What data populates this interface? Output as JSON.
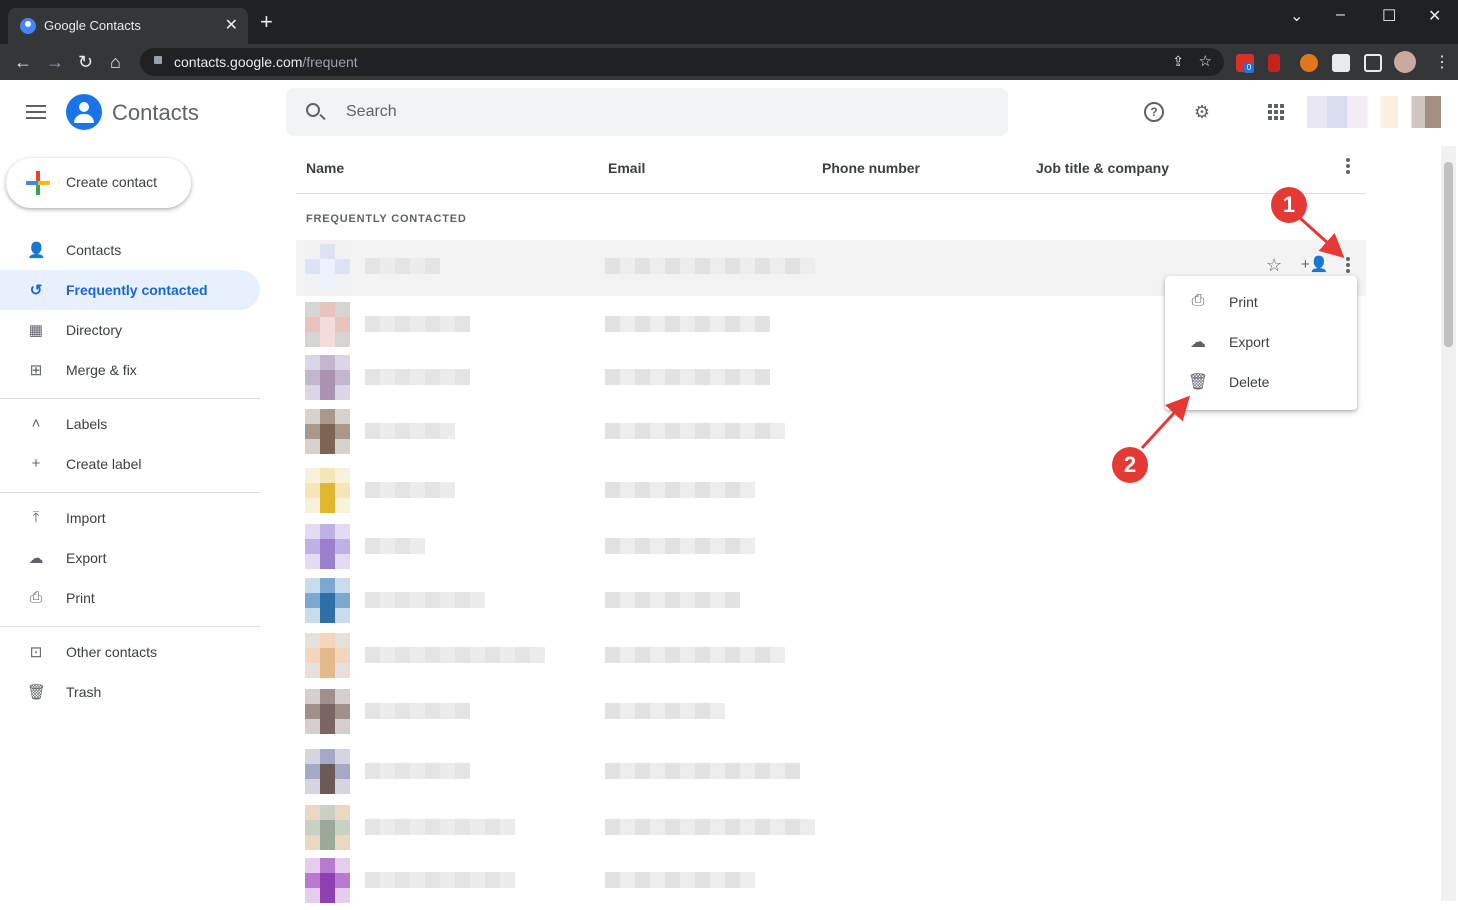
{
  "browser": {
    "tab_title": "Google Contacts",
    "tab_close": "✕",
    "new_tab": "+",
    "url_host": "contacts.google.com",
    "url_path": "/frequent",
    "extension_badge": "0"
  },
  "header": {
    "brand": "Contacts",
    "search_placeholder": "Search",
    "help_icon": "?"
  },
  "sidebar": {
    "create_label": "Create contact",
    "items": [
      {
        "label": "Contacts",
        "icon": "person-icon"
      },
      {
        "label": "Frequently contacted",
        "icon": "history-icon",
        "active": true
      },
      {
        "label": "Directory",
        "icon": "building-icon"
      },
      {
        "label": "Merge & fix",
        "icon": "merge-icon"
      }
    ],
    "labels_header": "Labels",
    "create_label_item": "Create label",
    "tools": [
      {
        "label": "Import",
        "icon": "upload-icon"
      },
      {
        "label": "Export",
        "icon": "cloud-upload-icon"
      },
      {
        "label": "Print",
        "icon": "print-icon"
      }
    ],
    "other": [
      {
        "label": "Other contacts",
        "icon": "archive-icon"
      },
      {
        "label": "Trash",
        "icon": "trash-icon"
      }
    ]
  },
  "table": {
    "columns": [
      "Name",
      "Email",
      "Phone number",
      "Job title & company"
    ],
    "section_label": "FREQUENTLY CONTACTED",
    "row_count": 12
  },
  "context_menu": {
    "items": [
      {
        "label": "Print",
        "icon": "print-icon"
      },
      {
        "label": "Export",
        "icon": "cloud-export-icon"
      },
      {
        "label": "Delete",
        "icon": "trash-icon"
      }
    ]
  },
  "annotations": [
    "1",
    "2"
  ],
  "colors": {
    "accent": "#1a73e8",
    "active_bg": "#e8f0fe",
    "badge": "#e53935"
  }
}
